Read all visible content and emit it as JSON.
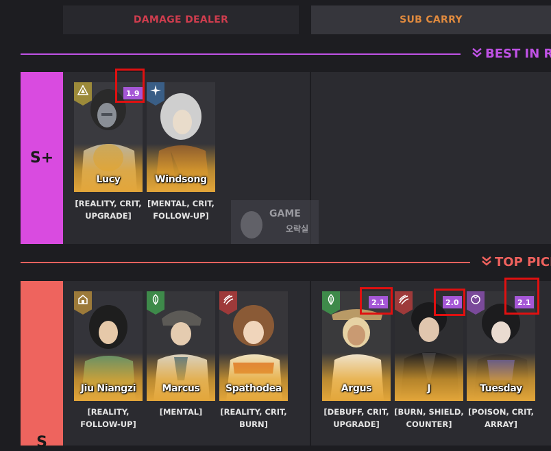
{
  "tabs": {
    "damage_dealer": "DAMAGE DEALER",
    "sub_carry": "SUB CARRY"
  },
  "sections": {
    "best": {
      "label": "BEST IN R",
      "color": "#c052e6"
    },
    "top": {
      "label": "TOP PICI",
      "color": "#f0625e"
    }
  },
  "tiers": {
    "splus": {
      "label": "S+",
      "color": "#d94be0"
    },
    "s": {
      "label": "S",
      "color": "#ee645e"
    }
  },
  "watermark": {
    "line1": "GAME",
    "line2": "오락실"
  },
  "cards": {
    "lucy": {
      "name": "Lucy",
      "score": "1.9",
      "tags": "[REALITY, CRIT, UPGRADE]",
      "element_color": "#9c8a3a",
      "element_icon": "reality-icon"
    },
    "windsong": {
      "name": "Windsong",
      "score": "",
      "tags": "[MENTAL, CRIT, FOLLOW-UP]",
      "element_color": "#3a5e86",
      "element_icon": "mental-icon"
    },
    "jiu": {
      "name": "Jiu Niangzi",
      "score": "",
      "tags": "[REALITY, FOLLOW-UP]",
      "element_color": "#9c7a3a",
      "element_icon": "reality-icon"
    },
    "marcus": {
      "name": "Marcus",
      "score": "",
      "tags": "[MENTAL]",
      "element_color": "#3e8a4a",
      "element_icon": "plant-icon"
    },
    "spathodea": {
      "name": "Spathodea",
      "score": "",
      "tags": "[REALITY, CRIT, BURN]",
      "element_color": "#9e3a3a",
      "element_icon": "claw-icon"
    },
    "argus": {
      "name": "Argus",
      "score": "2.1",
      "tags": "[DEBUFF, CRIT, UPGRADE]",
      "element_color": "#3e8a4a",
      "element_icon": "plant-icon"
    },
    "j": {
      "name": "J",
      "score": "2.0",
      "tags": "[BURN, SHIELD, COUNTER]",
      "element_color": "#9e3a3a",
      "element_icon": "claw-icon"
    },
    "tuesday": {
      "name": "Tuesday",
      "score": "2.1",
      "tags": "[POISON, CRIT, ARRAY]",
      "element_color": "#7a4a9a",
      "element_icon": "star-icon"
    }
  }
}
